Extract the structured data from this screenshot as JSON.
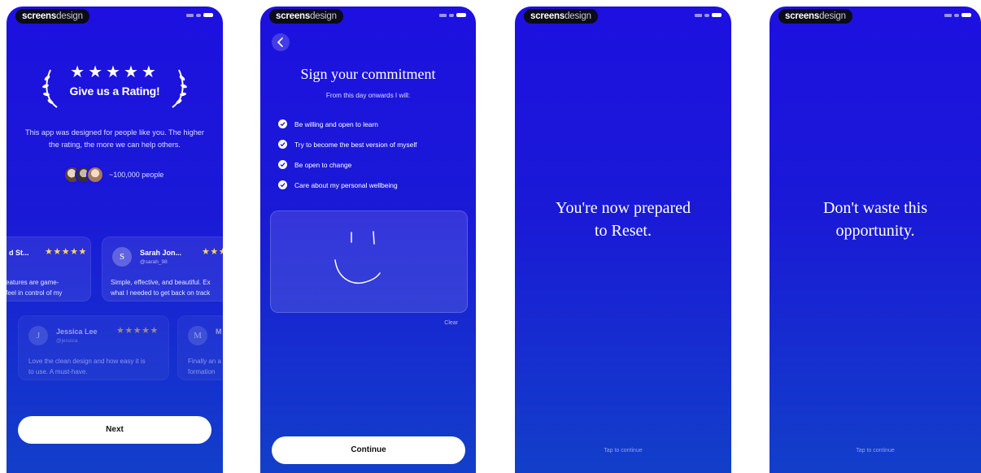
{
  "brand": {
    "bold": "screens",
    "light": "design"
  },
  "screen1": {
    "stars": "★★★★★",
    "title": "Give us a Rating!",
    "description": "This app was designed for people like you. The higher the rating, the more we can help others.",
    "people_count": "~100,000 people",
    "reviews": [
      {
        "initial": "",
        "name": "d St...",
        "handle": "",
        "stars": "★★★★★",
        "line1": "eatures are game-",
        "line2": "feel in control of my"
      },
      {
        "initial": "S",
        "name": "Sarah Jon...",
        "handle": "@sarah_98",
        "stars": "★★★",
        "line1": "Simple, effective, and beautiful. Ex",
        "line2": "what I needed to get back on track"
      },
      {
        "initial": "J",
        "name": "Jessica Lee",
        "handle": "@jessica",
        "stars": "★★★★★",
        "line1": "Love the clean design and how easy it is",
        "line2": "to use. A must-have."
      },
      {
        "initial": "M",
        "name": "M",
        "handle": "",
        "stars": "",
        "line1": "Finally an a",
        "line2": "formation"
      }
    ],
    "next_label": "Next"
  },
  "screen2": {
    "title": "Sign your commitment",
    "subtitle": "From this day onwards I will:",
    "items": [
      "Be willing and open to learn",
      "Try to become the best version of myself",
      "Be open to change",
      "Care about my personal wellbeing"
    ],
    "clear_label": "Clear",
    "continue_label": "Continue"
  },
  "screen3": {
    "line1": "You're now prepared",
    "line2": "to Reset.",
    "tap_label": "Tap to continue"
  },
  "screen4": {
    "line1": "Don't waste this",
    "line2": "opportunity.",
    "tap_label": "Tap to continue"
  },
  "colors": {
    "background": "#1d10e0",
    "star_gold": "#ffd36b",
    "button": "#ffffff"
  }
}
